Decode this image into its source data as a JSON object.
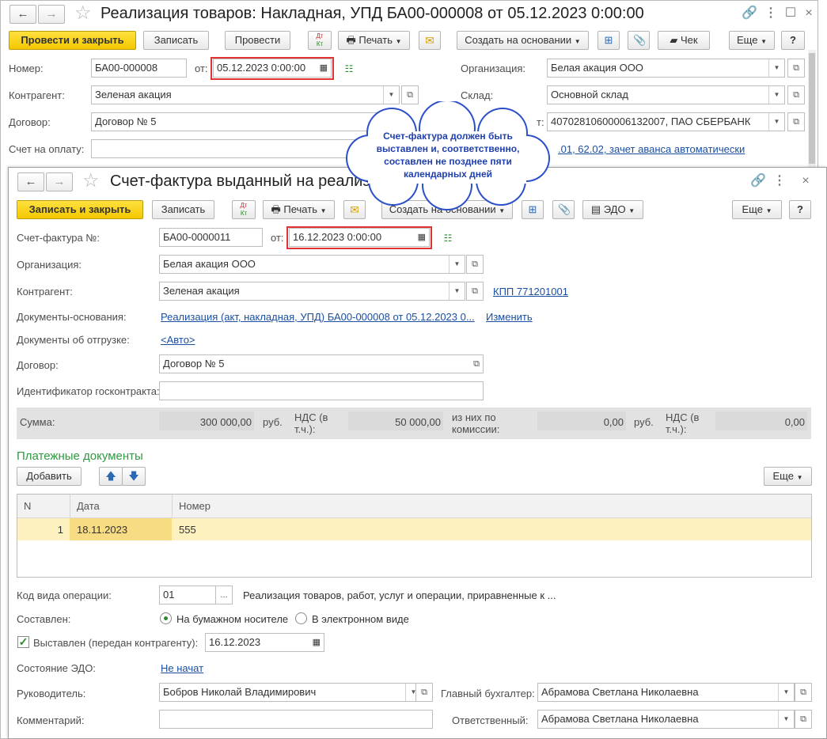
{
  "back_window": {
    "title": "Реализация товаров: Накладная, УПД БА00-000008 от 05.12.2023 0:00:00",
    "nav_back": "←",
    "nav_forward": "→",
    "toolbar": {
      "post_and_close": "Провести и закрыть",
      "save": "Записать",
      "post": "Провести",
      "dtkt": "ДтКт",
      "print": "Печать",
      "create_based_on": "Создать на основании",
      "receipt": "Чек",
      "more": "Еще",
      "help": "?"
    },
    "fields": {
      "number_label": "Номер:",
      "number_value": "БА00-000008",
      "from_label": "от:",
      "date_value": "05.12.2023  0:00:00",
      "organization_label": "Организация:",
      "organization_value": "Белая акация ООО",
      "counterparty_label": "Контрагент:",
      "counterparty_value": "Зеленая акация",
      "warehouse_label": "Склад:",
      "warehouse_value": "Основной склад",
      "contract_label": "Договор:",
      "contract_value": "Договор № 5",
      "account_label_partial": "т:",
      "account_value": "40702810600006132007, ПАО СБЕРБАНК",
      "invoice_label": "Счет на оплату:",
      "settlements_link": ".01, 62.02, зачет аванса автоматически"
    }
  },
  "callout": {
    "text": "Счет-фактура должен быть выставлен и, соответственно, составлен не позднее пяти календарных дней"
  },
  "front_window": {
    "title": "Счет-фактура выданный на реализац",
    "nav_back": "←",
    "nav_forward": "→",
    "toolbar": {
      "save_and_close": "Записать и закрыть",
      "save": "Записать",
      "dtkt": "ДтКт",
      "print": "Печать",
      "create_based_on": "Создать на основании",
      "edo": "ЭДО",
      "more": "Еще",
      "help": "?"
    },
    "fields": {
      "invoice_no_label": "Счет-фактура №:",
      "invoice_no_value": "БА00-0000011",
      "from_label": "от:",
      "date_value": "16.12.2023  0:00:00",
      "organization_label": "Организация:",
      "organization_value": "Белая акация ООО",
      "counterparty_label": "Контрагент:",
      "counterparty_value": "Зеленая акация",
      "kpp_link": "КПП 771201001",
      "base_docs_label": "Документы-основания:",
      "base_docs_link": "Реализация (акт, накладная, УПД) БА00-000008 от 05.12.2023 0...",
      "change_link": "Изменить",
      "shipment_docs_label": "Документы об отгрузке:",
      "shipment_docs_link": "<Авто>",
      "contract_label": "Договор:",
      "contract_value": "Договор № 5",
      "gov_contract_label": "Идентификатор госконтракта:",
      "gov_contract_value": ""
    },
    "sums": {
      "sum_label": "Сумма:",
      "sum_value": "300 000,00",
      "currency1": "руб.",
      "vat_label": "НДС (в т.ч.):",
      "vat_value": "50 000,00",
      "commission_label": "из них по комиссии:",
      "commission_value": "0,00",
      "currency2": "руб.",
      "vat2_label": "НДС (в т.ч.):",
      "vat2_value": "0,00"
    },
    "payments": {
      "section_title": "Платежные документы",
      "add_button": "Добавить",
      "up_icon": "arrow-up-icon",
      "down_icon": "arrow-down-icon",
      "more_button": "Еще",
      "columns": [
        "N",
        "Дата",
        "Номер"
      ],
      "rows": [
        {
          "n": "1",
          "date": "18.11.2023",
          "number": "555"
        }
      ]
    },
    "bottom": {
      "op_code_label": "Код вида операции:",
      "op_code_value": "01",
      "op_code_desc": "Реализация товаров, работ, услуг и операции, приравненные к ...",
      "composed_label": "Составлен:",
      "paper_option": "На бумажном носителе",
      "electronic_option": "В электронном виде",
      "issued_label": "Выставлен (передан контрагенту):",
      "issued_date": "16.12.2023",
      "edo_state_label": "Состояние ЭДО:",
      "edo_state_link": "Не начат",
      "head_label": "Руководитель:",
      "head_value": "Бобров Николай Владимирович",
      "accountant_label": "Главный бухгалтер:",
      "accountant_value": "Абрамова Светлана Николаевна",
      "comment_label": "Комментарий:",
      "comment_value": "",
      "responsible_label": "Ответственный:",
      "responsible_value": "Абрамова Светлана Николаевна"
    }
  },
  "colors": {
    "accent_yellow": "#f4c700",
    "link_blue": "#1a4fa3",
    "highlight_red": "#e03333",
    "section_green": "#2f9a41",
    "row_highlight": "#fdf1c0",
    "callout_border": "#2b4fc9"
  }
}
